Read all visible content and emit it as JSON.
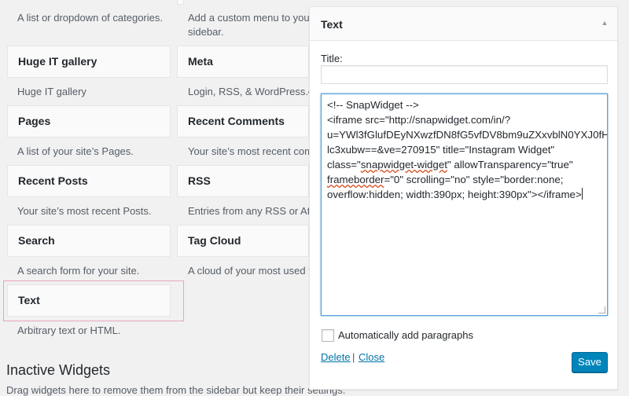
{
  "widgets": {
    "row0": {
      "left_desc": "A list or dropdown of categories.",
      "right_desc_line1": "Add a custom menu to your",
      "right_desc_line2": "sidebar."
    },
    "row1": {
      "left_title": "Huge IT gallery",
      "left_desc": "Huge IT gallery",
      "right_title": "Meta",
      "right_desc": "Login, RSS, & WordPress.org li"
    },
    "row2": {
      "left_title": "Pages",
      "left_desc": "A list of your site’s Pages.",
      "right_title": "Recent Comments",
      "right_desc": "Your site’s most recent comme"
    },
    "row3": {
      "left_title": "Recent Posts",
      "left_desc": "Your site’s most recent Posts.",
      "right_title": "RSS",
      "right_desc": "Entries from any RSS or Atom"
    },
    "row4": {
      "left_title": "Search",
      "left_desc": "A search form for your site.",
      "right_title": "Tag Cloud",
      "right_desc": "A cloud of your most used tag"
    },
    "row5": {
      "left_title": "Text",
      "left_desc": "Arbitrary text or HTML."
    }
  },
  "inactive": {
    "title": "Inactive Widgets",
    "desc": "Drag widgets here to remove them from the sidebar but keep their settings."
  },
  "editor": {
    "header_title": "Text",
    "toggle_icon": "▲",
    "title_label": "Title:",
    "title_value": "",
    "content_lines": [
      "<!-- SnapWidget -->",
      "<iframe src=\"http://snapwidget.com/in/?",
      "u=YWl3fGlufDEyNXwzfDN8fG5vfDV8bm9uZXxvblN0YXJ0fHl",
      "lc3xubw==&ve=270915\" title=\"Instagram Widget\"",
      "class=\"",
      "snapwidget-widget",
      "\" allowTransparency=\"true\"",
      "frameborder",
      "=\"0\" scrolling=\"no\" style=\"border:none;",
      "overflow:hidden; width:390px; height:390px\"></iframe>"
    ],
    "auto_paragraphs_label": "Automatically add paragraphs",
    "auto_paragraphs_checked": false,
    "delete_label": "Delete",
    "separator": "|",
    "close_label": "Close",
    "save_label": "Save"
  },
  "colors": {
    "primary": "#0085ba",
    "link": "#0073aa",
    "highlight_border": "#e7a6ba"
  }
}
